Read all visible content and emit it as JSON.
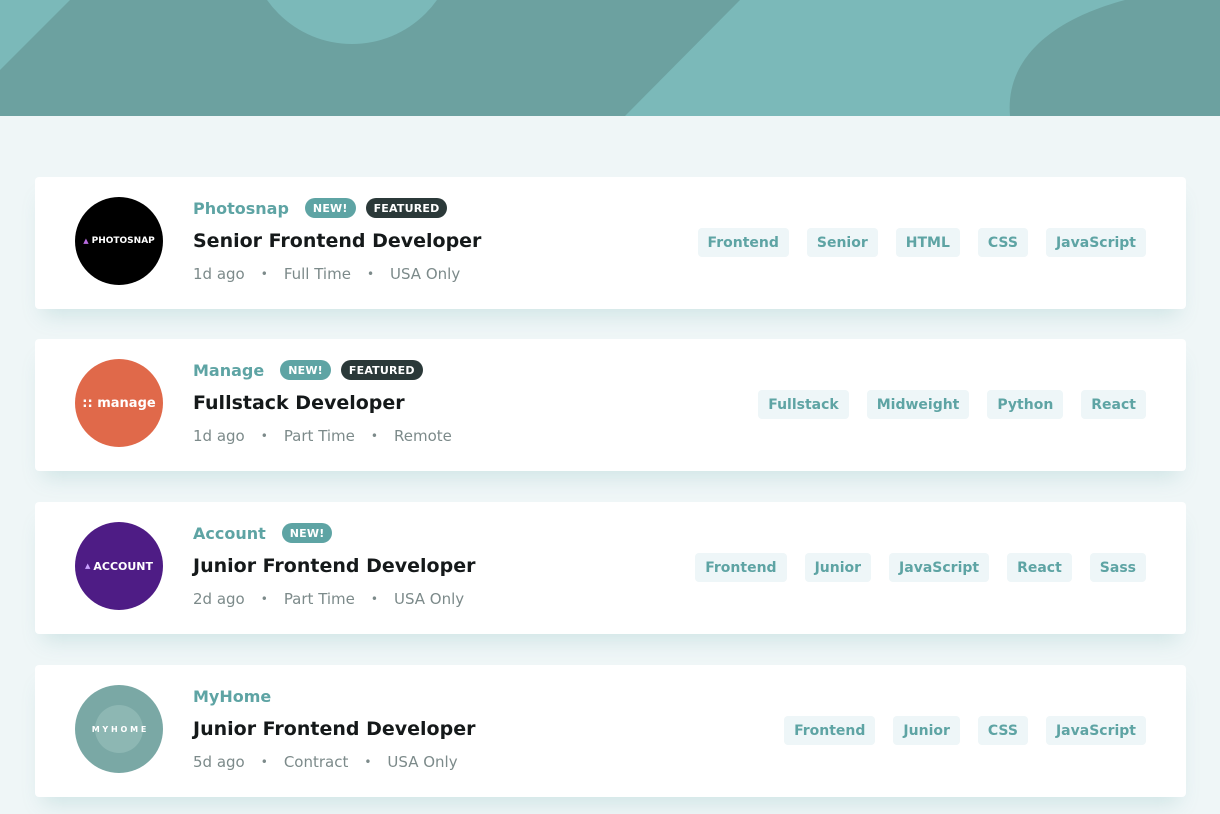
{
  "colors": {
    "primary": "#5ea4a4",
    "header_bg": "#7bb9b9",
    "page_bg": "#eff6f7",
    "featured_badge": "#2b3939",
    "tag_bg": "#eef6f8"
  },
  "jobs": [
    {
      "company": "Photosnap",
      "is_new": true,
      "new_label": "NEW!",
      "is_featured": true,
      "featured_label": "FEATURED",
      "position": "Senior Frontend Developer",
      "posted_at": "1d ago",
      "contract": "Full Time",
      "location": "USA Only",
      "logo_text": "PHOTOSNAP",
      "logo_color": "#000000",
      "tags": [
        "Frontend",
        "Senior",
        "HTML",
        "CSS",
        "JavaScript"
      ]
    },
    {
      "company": "Manage",
      "is_new": true,
      "new_label": "NEW!",
      "is_featured": true,
      "featured_label": "FEATURED",
      "position": "Fullstack Developer",
      "posted_at": "1d ago",
      "contract": "Part Time",
      "location": "Remote",
      "logo_text": ":: manage",
      "logo_color": "#e0694a",
      "tags": [
        "Fullstack",
        "Midweight",
        "Python",
        "React"
      ]
    },
    {
      "company": "Account",
      "is_new": true,
      "new_label": "NEW!",
      "is_featured": false,
      "position": "Junior Frontend Developer",
      "posted_at": "2d ago",
      "contract": "Part Time",
      "location": "USA Only",
      "logo_text": "ACCOUNT",
      "logo_color": "#4e1c85",
      "tags": [
        "Frontend",
        "Junior",
        "JavaScript",
        "React",
        "Sass"
      ]
    },
    {
      "company": "MyHome",
      "is_new": false,
      "is_featured": false,
      "position": "Junior Frontend Developer",
      "posted_at": "5d ago",
      "contract": "Contract",
      "location": "USA Only",
      "logo_text": "M Y H O M E",
      "logo_color": "#7aa8a5",
      "tags": [
        "Frontend",
        "Junior",
        "CSS",
        "JavaScript"
      ]
    }
  ]
}
